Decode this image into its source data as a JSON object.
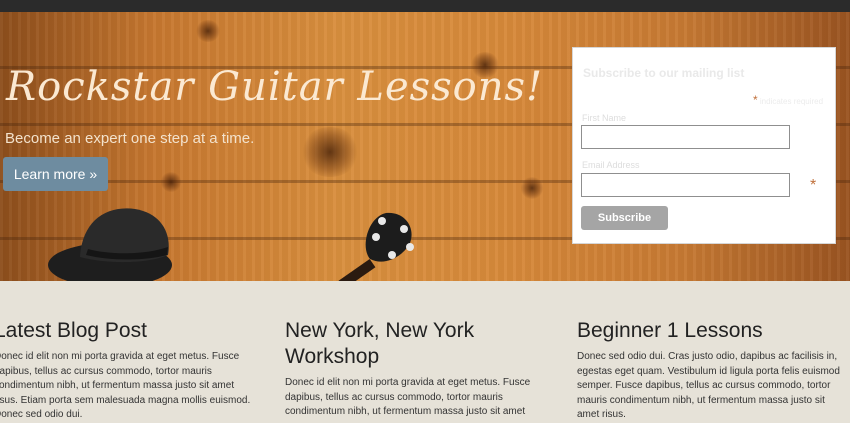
{
  "hero": {
    "title": "Rockstar Guitar Lessons!",
    "subtitle": "Become an expert one step at a time.",
    "cta_label": "Learn more »"
  },
  "signup": {
    "heading": "Subscribe to our mailing list",
    "required_star": "*",
    "required_note": "indicates required",
    "first_name_label": "First Name",
    "email_label": "Email Address",
    "email_required_star": "*",
    "subscribe_label": "Subscribe"
  },
  "columns": [
    {
      "title": "Latest Blog Post",
      "body": "Donec id elit non mi porta gravida at eget metus. Fusce dapibus, tellus ac cursus commodo, tortor mauris condimentum nibh, ut fermentum massa justo sit amet risus. Etiam porta sem malesuada magna mollis euismod. Donec sed odio dui."
    },
    {
      "title": "New York, New York Workshop",
      "body": "Donec id elit non mi porta gravida at eget metus. Fusce dapibus, tellus ac cursus commodo, tortor mauris condimentum nibh, ut fermentum massa justo sit amet"
    },
    {
      "title": "Beginner 1 Lessons",
      "body": "Donec sed odio dui. Cras justo odio, dapibus ac facilisis in, egestas eget quam. Vestibulum id ligula porta felis euismod semper. Fusce dapibus, tellus ac cursus commodo, tortor mauris condimentum nibh, ut fermentum massa justo sit amet risus."
    }
  ]
}
